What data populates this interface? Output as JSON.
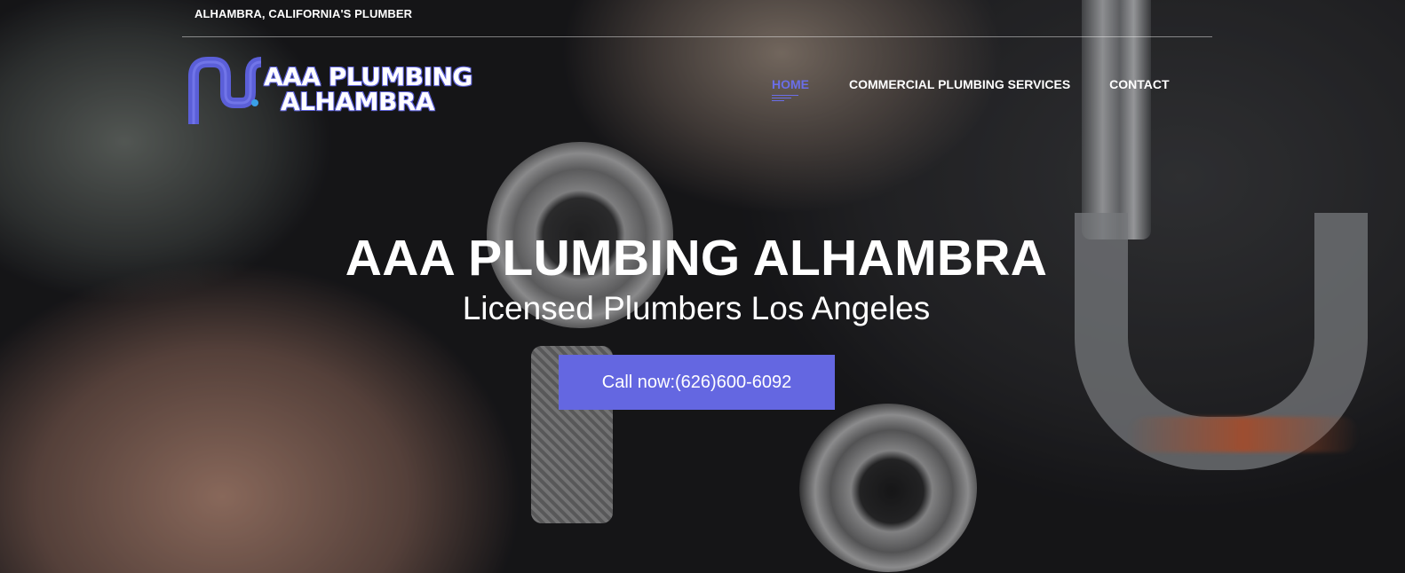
{
  "header": {
    "tagline": "ALHAMBRA, CALIFORNIA'S PLUMBER",
    "logo": {
      "line1": "AAA PLUMBING",
      "line2": "ALHAMBRA",
      "icon": "pipe-logo-icon"
    },
    "nav": {
      "items": [
        {
          "label": "HOME",
          "active": true
        },
        {
          "label": "COMMERCIAL PLUMBING SERVICES",
          "active": false
        },
        {
          "label": "CONTACT",
          "active": false
        }
      ]
    }
  },
  "hero": {
    "title": "AAA PLUMBING ALHAMBRA",
    "subtitle": "Licensed Plumbers Los Angeles",
    "cta_label": "Call now:(626)600-6092"
  },
  "colors": {
    "accent": "#6467e1",
    "nav_active": "#6a6ee8",
    "text": "#ffffff"
  }
}
